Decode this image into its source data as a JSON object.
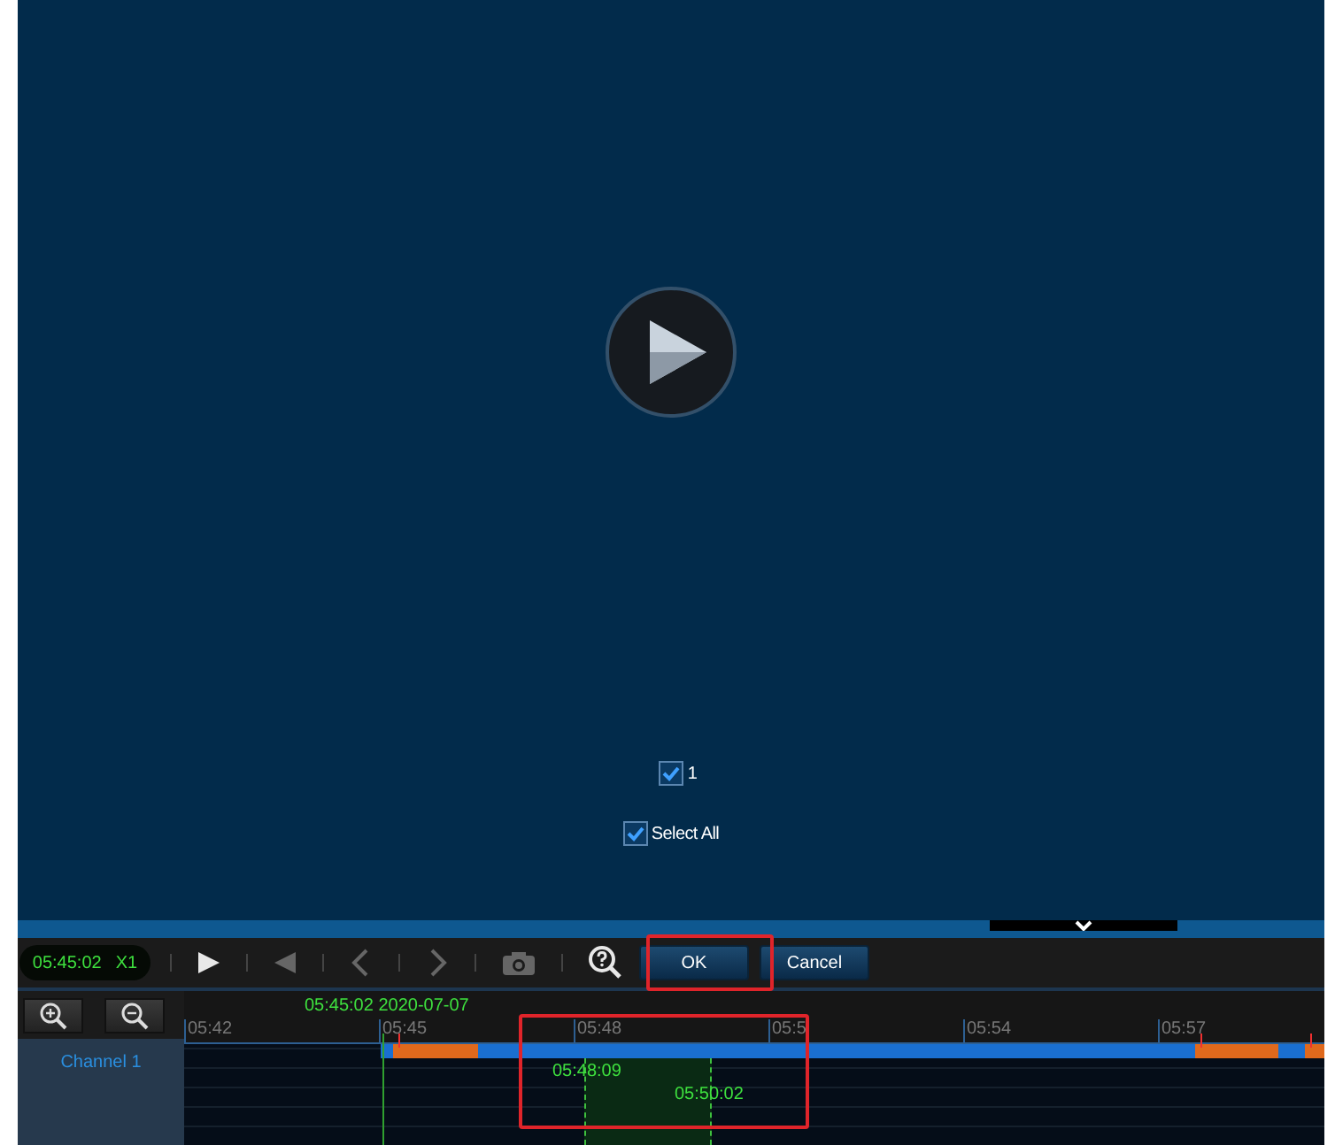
{
  "video": {
    "channels": [
      {
        "label": "1",
        "checked": true
      }
    ],
    "select_all": {
      "label": "Select All",
      "checked": true
    }
  },
  "toolbar": {
    "time": "05:45:02",
    "speed": "X1",
    "tools": [
      {
        "kind": "play",
        "disabled": false
      },
      {
        "kind": "reverse",
        "disabled": true
      },
      {
        "kind": "prev",
        "disabled": true
      },
      {
        "kind": "next",
        "disabled": true
      },
      {
        "kind": "snapshot",
        "disabled": true
      },
      {
        "kind": "zoom",
        "disabled": false
      }
    ],
    "buttons": [
      "OK",
      "Cancel"
    ]
  },
  "timeline": {
    "current": "05:45:02 2020-07-07",
    "ticks": [
      "05:42",
      "05:45",
      "05:48",
      "05:5",
      "05:54",
      "05:57"
    ],
    "channel": "Channel 1",
    "selection_start": "05:48:09",
    "selection_end": "05:50:02"
  }
}
